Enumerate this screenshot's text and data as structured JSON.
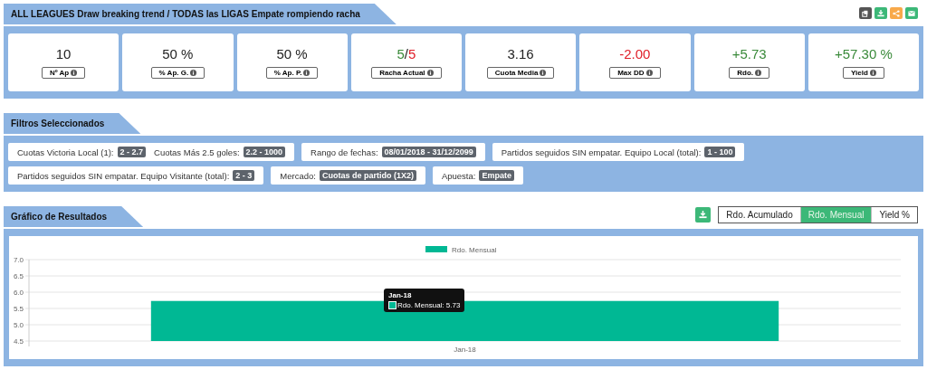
{
  "summary": {
    "title": "ALL LEAGUES Draw breaking trend / TODAS las LIGAS Empate rompiendo racha",
    "actions": [
      {
        "kind": "copy",
        "color": "#555555"
      },
      {
        "kind": "download",
        "color": "#3cb878"
      },
      {
        "kind": "share",
        "color": "#f8a94a"
      },
      {
        "kind": "mail",
        "color": "#3cb878"
      }
    ],
    "stats": [
      {
        "value": [
          {
            "text": "10",
            "color": "#222222"
          }
        ],
        "label": "Nº Ap"
      },
      {
        "value": [
          {
            "text": "50 %",
            "color": "#222222"
          }
        ],
        "label": "% Ap. G."
      },
      {
        "value": [
          {
            "text": "50 %",
            "color": "#222222"
          }
        ],
        "label": "% Ap. P."
      },
      {
        "value": [
          {
            "text": "5",
            "color": "#3a8a3a"
          },
          {
            "text": "/",
            "color": "#222222"
          },
          {
            "text": "5",
            "color": "#e0202a"
          }
        ],
        "label": "Racha Actual"
      },
      {
        "value": [
          {
            "text": "3.16",
            "color": "#222222"
          }
        ],
        "label": "Cuota Media"
      },
      {
        "value": [
          {
            "text": "-2.00",
            "color": "#e0202a"
          }
        ],
        "label": "Max DD"
      },
      {
        "value": [
          {
            "text": "+5.73",
            "color": "#3a8a3a"
          }
        ],
        "label": "Rdo."
      },
      {
        "value": [
          {
            "text": "+57.30 %",
            "color": "#3a8a3a"
          }
        ],
        "label": "Yield"
      }
    ]
  },
  "filters": {
    "title": "Filtros Seleccionados",
    "chips": [
      {
        "parts": [
          {
            "label": "Cuotas Victoria Local (1):",
            "badge": "2 - 2.7"
          },
          {
            "label": "Cuotas Más 2.5 goles:",
            "badge": "2.2 - 1000"
          }
        ]
      },
      {
        "parts": [
          {
            "label": "Rango de fechas:",
            "badge": "08/01/2018 - 31/12/2099"
          }
        ]
      },
      {
        "parts": [
          {
            "label": "Partidos seguidos SIN empatar. Equipo Local (total):",
            "badge": "1 - 100"
          }
        ]
      },
      {
        "parts": [
          {
            "label": "Partidos seguidos SIN empatar. Equipo Visitante (total):",
            "badge": "2 - 3"
          }
        ]
      },
      {
        "parts": [
          {
            "label": "Mercado:",
            "badge": "Cuotas de partido (1X2)"
          }
        ]
      },
      {
        "parts": [
          {
            "label": "Apuesta:",
            "badge": "Empate"
          }
        ]
      }
    ]
  },
  "results": {
    "title": "Gráfico de Resultados",
    "toggles": [
      {
        "label": "Rdo. Acumulado",
        "selected": false
      },
      {
        "label": "Rdo. Mensual",
        "selected": true
      },
      {
        "label": "Yield %",
        "selected": false
      }
    ],
    "chart_data": {
      "type": "bar",
      "grid": true,
      "categories": [
        "Jan-18"
      ],
      "series": [
        {
          "name": "Rdo. Mensual",
          "color": "#00b894",
          "values": [
            5.73
          ]
        }
      ],
      "ylim": [
        4.5,
        7.0
      ],
      "yticks": [
        {
          "value": 4.5,
          "label": "4.5"
        },
        {
          "value": 5,
          "label": "5.0"
        },
        {
          "value": 5.5,
          "label": "5.5"
        },
        {
          "value": 6,
          "label": "6.0"
        },
        {
          "value": 6.5,
          "label": "6.5"
        },
        {
          "value": 7,
          "label": "7.0"
        }
      ]
    },
    "tooltip": {
      "title": "Jan-18",
      "label": "Rdo. Mensual: 5.73"
    }
  }
}
